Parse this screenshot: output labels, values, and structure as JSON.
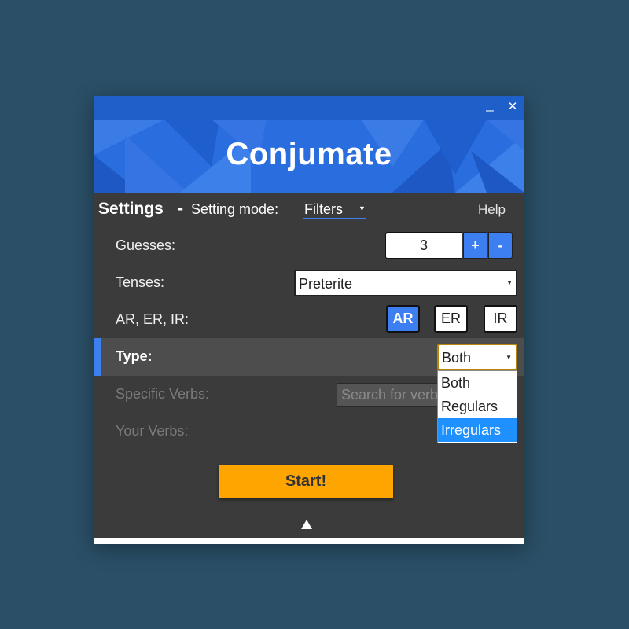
{
  "window": {
    "minimize_glyph": "_",
    "close_glyph": "✕",
    "banner_title": "Conjumate"
  },
  "settings": {
    "title": "Settings",
    "dash": "-",
    "mode_label": "Setting mode:",
    "mode_value": "Filters",
    "help_label": "Help"
  },
  "guesses": {
    "label": "Guesses:",
    "value": "3",
    "plus_label": "+",
    "minus_label": "-"
  },
  "tenses": {
    "label": "Tenses:",
    "value": "Preterite"
  },
  "endings": {
    "label": "AR, ER, IR:",
    "buttons": [
      {
        "label": "AR",
        "active": true
      },
      {
        "label": "ER",
        "active": false
      },
      {
        "label": "IR",
        "active": false
      }
    ]
  },
  "type": {
    "label": "Type:",
    "value": "Both",
    "options": [
      "Both",
      "Regulars",
      "Irregulars"
    ],
    "highlighted_option": "Irregulars"
  },
  "specific_verbs": {
    "label": "Specific Verbs:",
    "placeholder": "Search for verbs"
  },
  "your_verbs": {
    "label": "Your Verbs:"
  },
  "start_label": "Start!",
  "colors": {
    "background": "#2a4f66",
    "panel": "#3b3b3b",
    "accent_blue": "#3d7ff0",
    "start_orange": "#ffa500",
    "highlight_option": "#1e90ff"
  },
  "icons": [
    "minimize-icon",
    "close-icon",
    "dropdown-arrow-icon",
    "collapse-arrow-icon"
  ]
}
